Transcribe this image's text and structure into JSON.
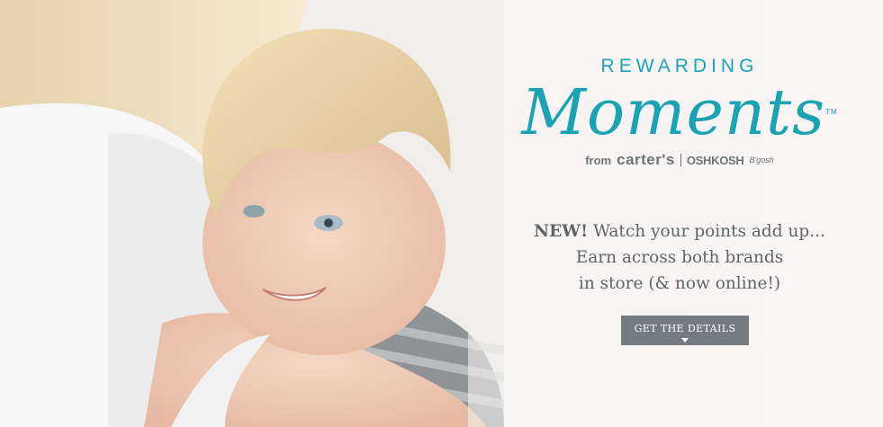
{
  "brand": {
    "kicker": "REWARDING",
    "script": "Moments",
    "trademark": "TM",
    "from": "from",
    "carters": "carter's",
    "oshkosh": "OSHKOSH",
    "bgosh": "B'gosh"
  },
  "copy": {
    "new": "NEW!",
    "line1": "Watch your points add up...",
    "line2": "Earn across both brands",
    "line3": "in store (& now online!)"
  },
  "cta": {
    "label": "GET THE DETAILS"
  },
  "colors": {
    "teal": "#1aa3b2",
    "button": "#717b80",
    "text": "#5f6568"
  }
}
